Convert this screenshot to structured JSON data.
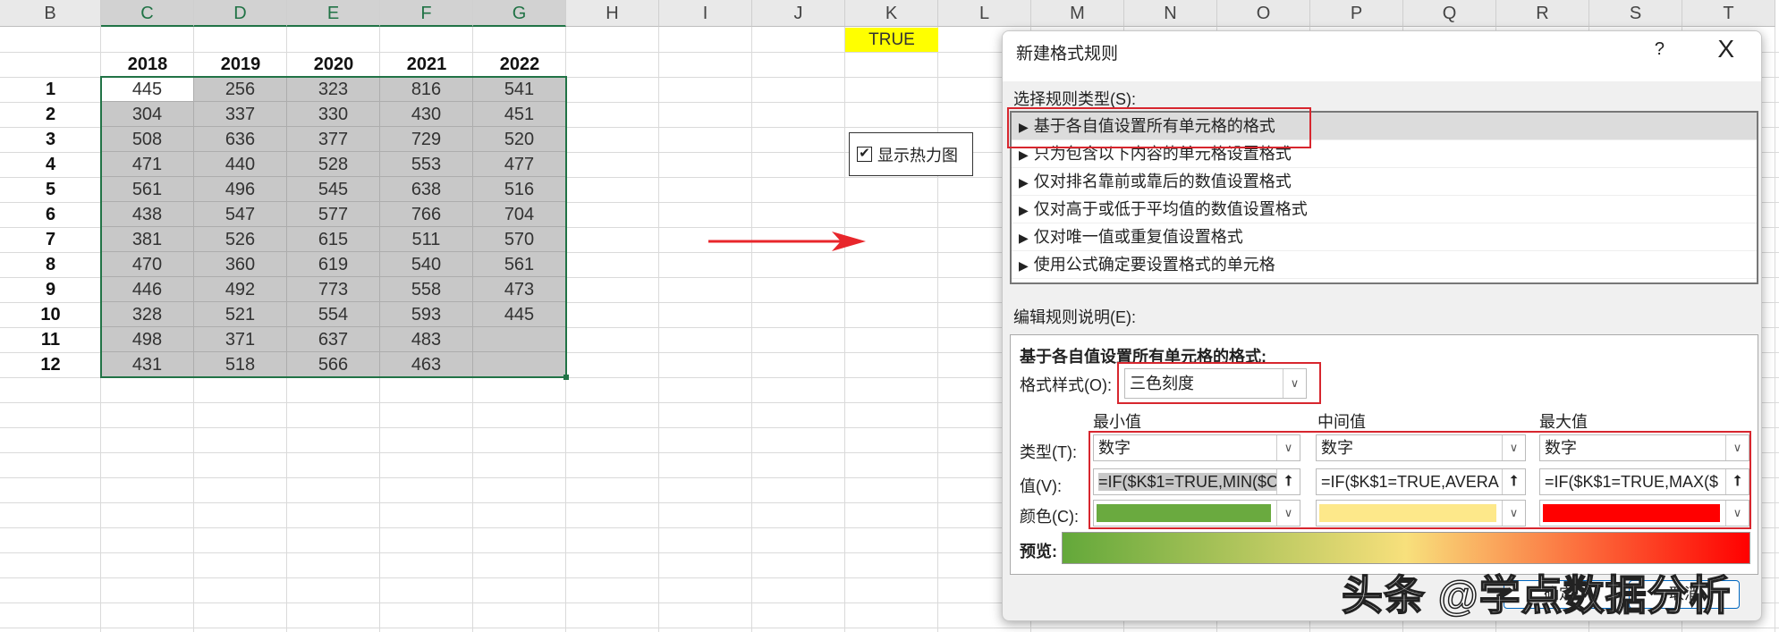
{
  "sheet": {
    "columns": [
      "B",
      "C",
      "D",
      "E",
      "F",
      "G",
      "H",
      "I",
      "J",
      "K",
      "L",
      "M",
      "N",
      "O",
      "P",
      "Q",
      "R",
      "S",
      "T"
    ],
    "selected_columns": [
      "C",
      "D",
      "E",
      "F",
      "G"
    ],
    "years": [
      "2018",
      "2019",
      "2020",
      "2021",
      "2022"
    ],
    "row_labels": [
      "1",
      "2",
      "3",
      "4",
      "5",
      "6",
      "7",
      "8",
      "9",
      "10",
      "11",
      "12"
    ],
    "values": [
      [
        445,
        256,
        323,
        816,
        541
      ],
      [
        304,
        337,
        330,
        430,
        451
      ],
      [
        508,
        636,
        377,
        729,
        520
      ],
      [
        471,
        440,
        528,
        553,
        477
      ],
      [
        561,
        496,
        545,
        638,
        516
      ],
      [
        438,
        547,
        577,
        766,
        704
      ],
      [
        381,
        526,
        615,
        511,
        570
      ],
      [
        470,
        360,
        619,
        540,
        561
      ],
      [
        446,
        492,
        773,
        558,
        473
      ],
      [
        328,
        521,
        554,
        593,
        445
      ],
      [
        498,
        371,
        637,
        483,
        null
      ],
      [
        431,
        518,
        566,
        463,
        null
      ]
    ],
    "k1_value": "TRUE",
    "checkbox_label": "显示热力图",
    "checkbox_checked": true
  },
  "dialog": {
    "title": "新建格式规则",
    "help": "?",
    "close": "X",
    "rule_type_label": "选择规则类型(S):",
    "rule_types": [
      "基于各自值设置所有单元格的格式",
      "只为包含以下内容的单元格设置格式",
      "仅对排名靠前或靠后的数值设置格式",
      "仅对高于或低于平均值的数值设置格式",
      "仅对唯一值或重复值设置格式",
      "使用公式确定要设置格式的单元格"
    ],
    "edit_label": "编辑规则说明(E):",
    "group_title": "基于各自值设置所有单元格的格式:",
    "style_label": "格式样式(O):",
    "style_value": "三色刻度",
    "col_min": "最小值",
    "col_mid": "中间值",
    "col_max": "最大值",
    "type_label": "类型(T):",
    "value_label": "值(V):",
    "color_label": "颜色(C):",
    "types": [
      "数字",
      "数字",
      "数字"
    ],
    "values": [
      "=IF($K$1=TRUE,MIN($C",
      "=IF($K$1=TRUE,AVERA",
      "=IF($K$1=TRUE,MAX($"
    ],
    "colors": [
      "#6aaa3f",
      "#fde88a",
      "#ff0000"
    ],
    "preview_label": "预览:",
    "ok": "确定",
    "cancel": "取消"
  },
  "watermark": "头条 @学点数据分析"
}
